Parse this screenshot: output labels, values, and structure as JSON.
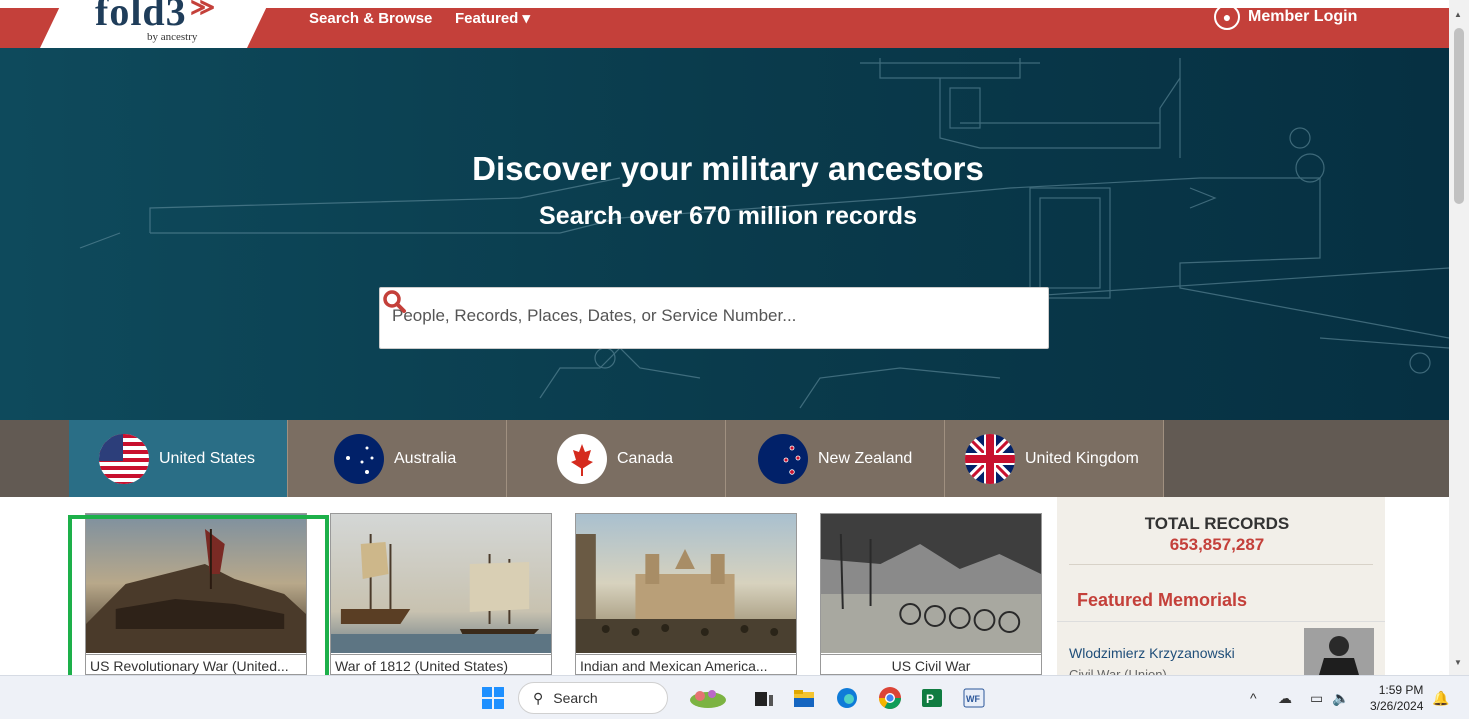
{
  "header": {
    "logo_text": "fold3",
    "logo_byline": "by ancestry",
    "nav_search_browse": "Search & Browse",
    "nav_featured": "Featured ▾",
    "login_label": "Member Login"
  },
  "hero": {
    "title": "Discover your military ancestors",
    "subtitle": "Search over 670 million records",
    "search_placeholder": "People, Records, Places, Dates, or Service Number..."
  },
  "countries": [
    {
      "label": "United States",
      "active": true
    },
    {
      "label": "Australia",
      "active": false
    },
    {
      "label": "Canada",
      "active": false
    },
    {
      "label": "New Zealand",
      "active": false
    },
    {
      "label": "United Kingdom",
      "active": false
    }
  ],
  "collections": [
    {
      "caption": "US Revolutionary War (United..."
    },
    {
      "caption": "War of 1812 (United States)"
    },
    {
      "caption": "Indian and Mexican America..."
    },
    {
      "caption": "US Civil War"
    }
  ],
  "sidebar": {
    "total_label": "TOTAL RECORDS",
    "total_count": "653,857,287",
    "featured_title": "Featured Memorials",
    "memorial_name": "Wlodzimierz Krzyzanowski",
    "memorial_sub": "Civil War (Union)"
  },
  "taskbar": {
    "search_label": "Search",
    "time": "1:59 PM",
    "date": "3/26/2024"
  },
  "colors": {
    "brand_red": "#c4403a",
    "hero_teal": "#0a3b4c",
    "tab_active": "#2a6e86",
    "highlight_green": "#1db04a"
  }
}
